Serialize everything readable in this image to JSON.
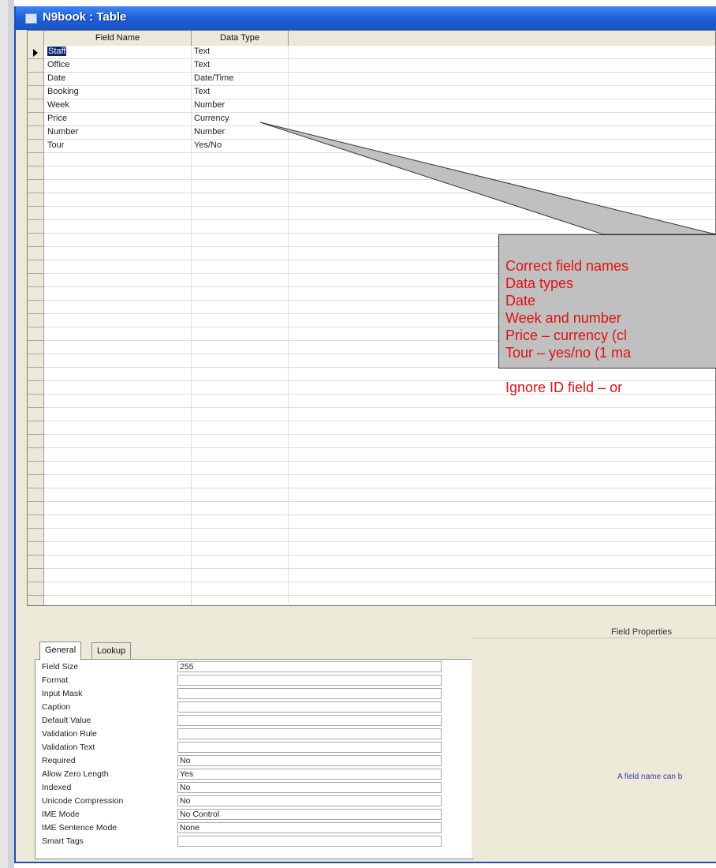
{
  "window": {
    "title": "N9book : Table"
  },
  "grid": {
    "columns": [
      "Field Name",
      "Data Type"
    ],
    "rows": [
      {
        "field": "Staff",
        "type": "Text"
      },
      {
        "field": "Office",
        "type": "Text"
      },
      {
        "field": "Date",
        "type": "Date/Time"
      },
      {
        "field": "Booking",
        "type": "Text"
      },
      {
        "field": "Week",
        "type": "Number"
      },
      {
        "field": "Price",
        "type": "Currency"
      },
      {
        "field": "Number",
        "type": "Number"
      },
      {
        "field": "Tour",
        "type": "Yes/No"
      }
    ]
  },
  "properties": {
    "section_label": "Field Properties",
    "tabs": [
      "General",
      "Lookup"
    ],
    "rows": [
      {
        "name": "Field Size",
        "value": "255"
      },
      {
        "name": "Format",
        "value": ""
      },
      {
        "name": "Input Mask",
        "value": ""
      },
      {
        "name": "Caption",
        "value": ""
      },
      {
        "name": "Default Value",
        "value": ""
      },
      {
        "name": "Validation Rule",
        "value": ""
      },
      {
        "name": "Validation Text",
        "value": ""
      },
      {
        "name": "Required",
        "value": "No"
      },
      {
        "name": "Allow Zero Length",
        "value": "Yes"
      },
      {
        "name": "Indexed",
        "value": "No"
      },
      {
        "name": "Unicode Compression",
        "value": "No"
      },
      {
        "name": "IME Mode",
        "value": "No Control"
      },
      {
        "name": "IME Sentence Mode",
        "value": "None"
      },
      {
        "name": "Smart Tags",
        "value": ""
      }
    ],
    "help_text": "A field name can b"
  },
  "callout": {
    "lines": [
      "Correct field names",
      "Data types",
      "Date",
      "Week and number",
      "Price – currency (cl",
      "Tour – yes/no (1 ma",
      "",
      "Ignore ID field – or"
    ],
    "text_color": "#e01010",
    "background": "#c0c0c0"
  },
  "colors": {
    "titlebar": "#1f5fd8",
    "window_bg": "#ece9d8",
    "selection": "#0a246a"
  }
}
